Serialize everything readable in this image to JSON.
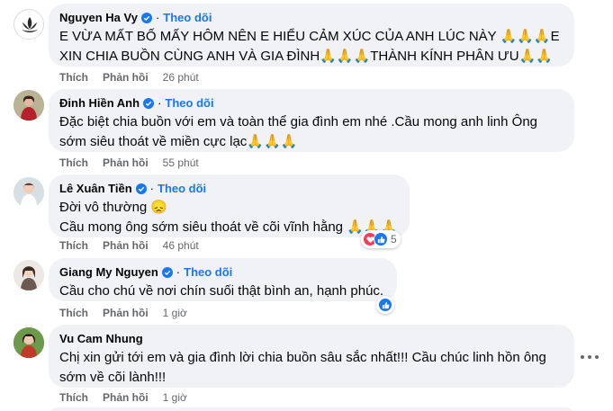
{
  "follow_label": "Theo dõi",
  "like_label": "Thích",
  "reply_label": "Phản hồi",
  "colors": {
    "follow": "#1877f2",
    "bubble": "#f0f2f5",
    "meta": "#65676b",
    "like": "#1877f2",
    "love": "#f33e58"
  },
  "comments": [
    {
      "author": "Nguyen Ha Vy",
      "verified": true,
      "follow": true,
      "lines": [
        "E VỪA MẤT BỐ MẤY HÔM NÊN E HIỂU CẢM XÚC CỦA ANH LÚC NÀY 🙏🙏🙏E",
        "XIN CHIA BUỒN CÙNG ANH VÀ GIA ĐÌNH🙏🙏🙏THÀNH KÍNH PHÂN ƯU🙏🙏"
      ],
      "time": "26 phút"
    },
    {
      "author": "Đinh Hiền Anh",
      "verified": true,
      "follow": true,
      "lines": [
        "Đặc biệt chia buồn với em và toàn thể gia đình em nhé .Cầu mong anh linh Ông",
        "sớm siêu thoát về miền cực lạc🙏🙏🙏"
      ],
      "time": "55 phút"
    },
    {
      "author": "Lê Xuân Tiền",
      "verified": true,
      "follow": true,
      "lines": [
        "Đời vô thường 😞",
        "Cầu mong ông sớm siêu thoát về cõi vĩnh hằng 🙏🙏🙏"
      ],
      "time": "46 phút",
      "reaction_count": "5",
      "reactions": [
        "love-icon",
        "like-icon"
      ]
    },
    {
      "author": "Giang My Nguyen",
      "verified": true,
      "follow": true,
      "lines": [
        "Cầu cho chú về nơi chín suối thật bình an, hạnh phúc."
      ],
      "time": "1 giờ",
      "reactions": [
        "like-icon"
      ]
    },
    {
      "author": "Vu Cam Nhung",
      "verified": false,
      "follow": false,
      "lines": [
        "Chị xin gửi tới em và gia đình lời chia buồn sâu sắc nhất!!! Cầu chúc linh hồn ông",
        "sớm về cõi lành!!!"
      ],
      "time": "1 giờ"
    }
  ]
}
